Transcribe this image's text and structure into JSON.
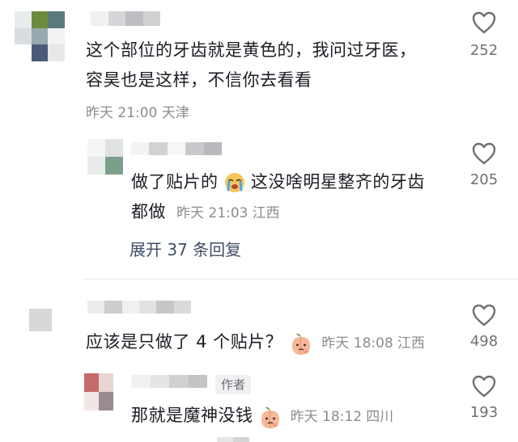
{
  "comments": [
    {
      "id": "c1",
      "text_line1": "这个部位的牙齿就是黄色的，我问过牙医，",
      "text_line2": "容昊也是这样，不信你去看看",
      "time": "昨天 21:00",
      "location": "天津",
      "likes": "252"
    },
    {
      "id": "r1",
      "text_before_emoji": "做了贴片的",
      "text_after_emoji": "这没啥明星整齐的牙齿",
      "text_line2": "都做",
      "time": "昨天 21:03",
      "location": "江西",
      "likes": "205",
      "expand_label": "展开 37 条回复"
    },
    {
      "id": "c2",
      "text": "应该是只做了 4 个贴片？",
      "time": "昨天 18:08",
      "location": "江西",
      "likes": "498"
    },
    {
      "id": "r2",
      "author_badge": "作者",
      "text": "那就是魔神没钱",
      "time": "昨天 18:12",
      "location": "四川",
      "likes": "193"
    }
  ],
  "icons": {
    "like": "heart-outline-icon",
    "crying_emoji": "crying-face-emoji",
    "peach_emoji": "peach-thinking-emoji"
  },
  "colors": {
    "text": "#1c1c24",
    "meta": "#8a8b91",
    "expand": "#3f4d66"
  }
}
